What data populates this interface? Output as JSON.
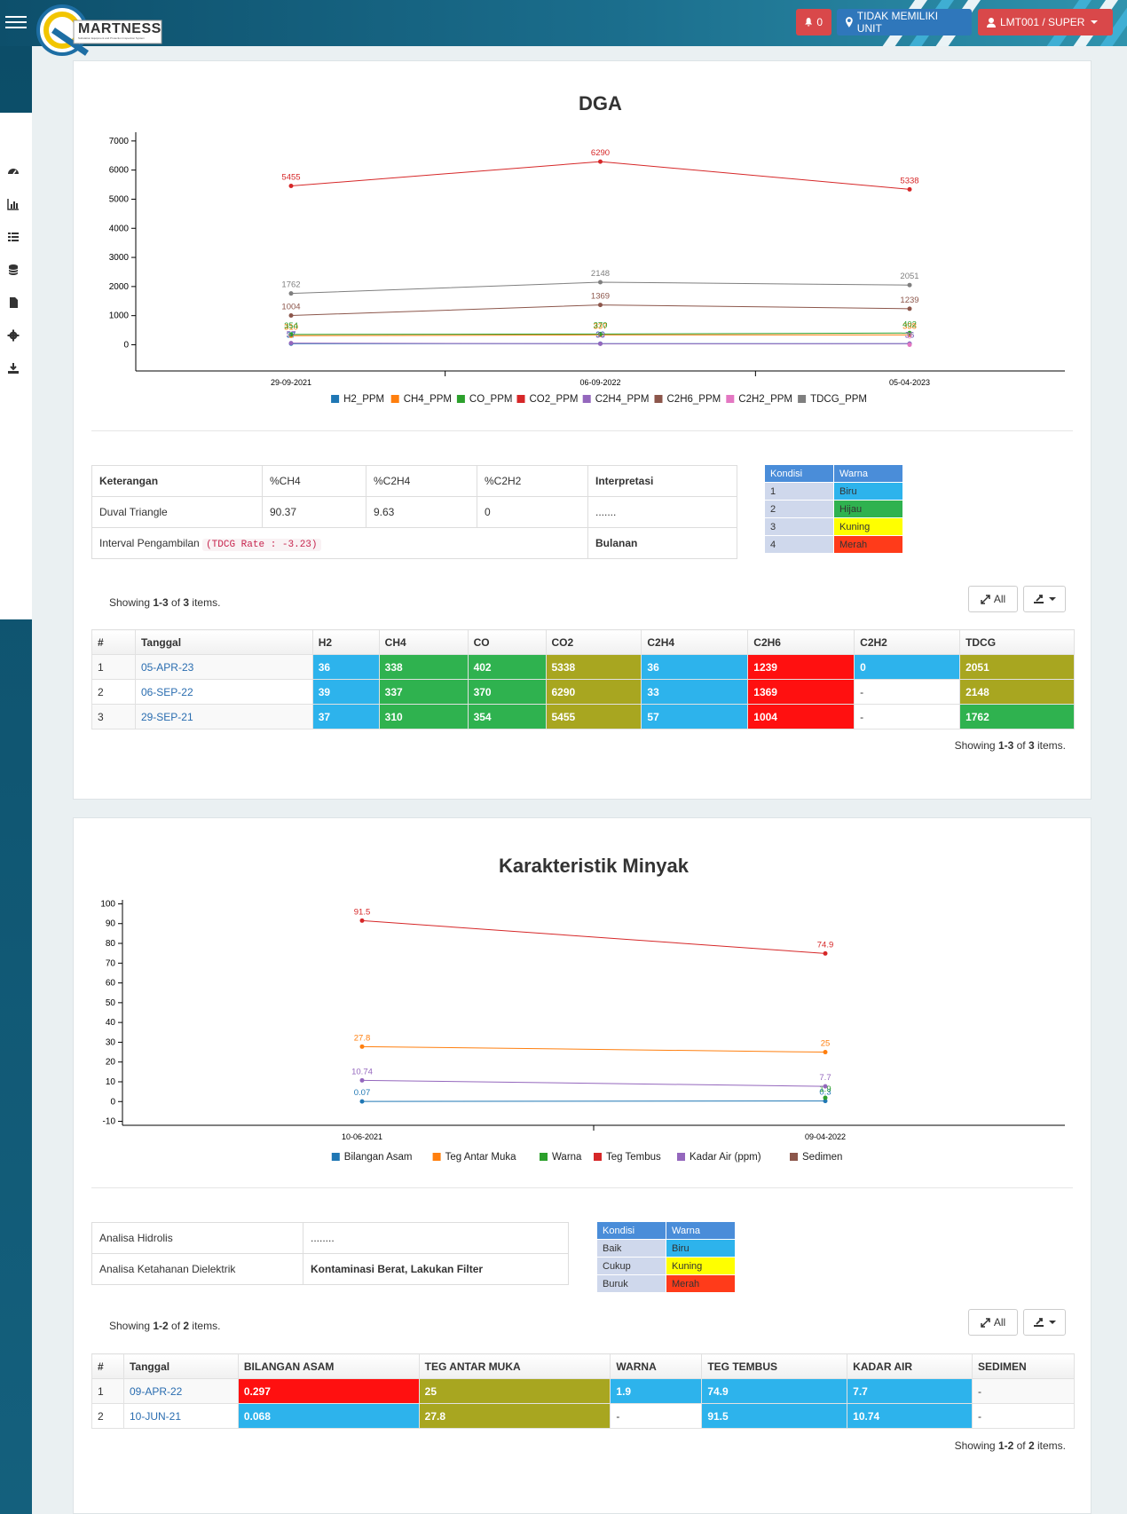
{
  "topbar": {
    "logo_text": "MARTNESS",
    "logo_sub": "Substation Equipment and Protection Inspection System",
    "notif_count": "0",
    "unit_label": "TIDAK MEMILIKI UNIT",
    "user_label": "LMT001 / SUPER"
  },
  "colors": {
    "blue": "#2db3ec",
    "green": "#2fb24f",
    "yellow": "#ffff00",
    "olive": "#a8a620",
    "red": "#ff1010"
  },
  "dga": {
    "chart_data": {
      "type": "line",
      "title": "DGA",
      "categories": [
        "29-09-2021",
        "06-09-2022",
        "05-04-2023"
      ],
      "ylim": [
        -900,
        7300
      ],
      "yticks": [
        0,
        1000,
        2000,
        3000,
        4000,
        5000,
        6000,
        7000
      ],
      "legend_position": "bottom",
      "series": [
        {
          "name": "H2_PPM",
          "color": "#1f77b4",
          "values": [
            37,
            39,
            36
          ]
        },
        {
          "name": "CH4_PPM",
          "color": "#ff7f0e",
          "values": [
            310,
            337,
            338
          ]
        },
        {
          "name": "CO_PPM",
          "color": "#2ca02c",
          "values": [
            354,
            370,
            402
          ]
        },
        {
          "name": "CO2_PPM",
          "color": "#d62728",
          "values": [
            5455,
            6290,
            5338
          ]
        },
        {
          "name": "C2H4_PPM",
          "color": "#9467bd",
          "values": [
            57,
            33,
            36
          ]
        },
        {
          "name": "C2H6_PPM",
          "color": "#8c564b",
          "values": [
            1004,
            1369,
            1239
          ]
        },
        {
          "name": "C2H2_PPM",
          "color": "#e377c2",
          "values": [
            null,
            null,
            0
          ]
        },
        {
          "name": "TDCG_PPM",
          "color": "#7f7f7f",
          "values": [
            1762,
            2148,
            2051
          ]
        }
      ]
    },
    "info": {
      "headers": [
        "Keterangan",
        "%CH4",
        "%C2H4",
        "%C2H2",
        "Interpretasi"
      ],
      "duval": [
        "Duval Triangle",
        "90.37",
        "9.63",
        "0",
        "......."
      ],
      "interval_label": "Interval Pengambilan",
      "interval_code": "(TDCG Rate : -3.23)",
      "interval_value": "Bulanan"
    },
    "kondisi": {
      "headers": [
        "Kondisi",
        "Warna"
      ],
      "rows": [
        [
          "1",
          "Biru",
          "#2db3ec"
        ],
        [
          "2",
          "Hijau",
          "#2fb24f"
        ],
        [
          "3",
          "Kuning",
          "#ffff00"
        ],
        [
          "4",
          "Merah",
          "#ff3b1a"
        ]
      ]
    },
    "summary": {
      "pre": "Showing ",
      "range": "1-3",
      "mid": " of ",
      "total": "3",
      "post": " items."
    },
    "all_label": "All",
    "table": {
      "headers": [
        "#",
        "Tanggal",
        "H2",
        "CH4",
        "CO",
        "CO2",
        "C2H4",
        "C2H6",
        "C2H2",
        "TDCG"
      ],
      "rows": [
        [
          [
            "1",
            "p"
          ],
          [
            "05-APR-23",
            "lnk"
          ],
          [
            "36",
            "cblue"
          ],
          [
            "338",
            "cgreen"
          ],
          [
            "402",
            "cgreen"
          ],
          [
            "5338",
            "colive"
          ],
          [
            "36",
            "cblue"
          ],
          [
            "1239",
            "cred"
          ],
          [
            "0",
            "cblue"
          ],
          [
            "2051",
            "colive"
          ]
        ],
        [
          [
            "2",
            "p"
          ],
          [
            "06-SEP-22",
            "lnk"
          ],
          [
            "39",
            "cblue"
          ],
          [
            "337",
            "cgreen"
          ],
          [
            "370",
            "cgreen"
          ],
          [
            "6290",
            "colive"
          ],
          [
            "33",
            "cblue"
          ],
          [
            "1369",
            "cred"
          ],
          [
            "-",
            "cwhite"
          ],
          [
            "2148",
            "colive"
          ]
        ],
        [
          [
            "3",
            "p"
          ],
          [
            "29-SEP-21",
            "lnk"
          ],
          [
            "37",
            "cblue"
          ],
          [
            "310",
            "cgreen"
          ],
          [
            "354",
            "cgreen"
          ],
          [
            "5455",
            "colive"
          ],
          [
            "57",
            "cblue"
          ],
          [
            "1004",
            "cred"
          ],
          [
            "-",
            "cwhite"
          ],
          [
            "1762",
            "cgreen"
          ]
        ]
      ]
    }
  },
  "minyak": {
    "chart_data": {
      "type": "line",
      "title": "Karakteristik Minyak",
      "categories": [
        "10-06-2021",
        "09-04-2022"
      ],
      "ylim": [
        -12,
        102
      ],
      "yticks": [
        -10,
        0,
        10,
        20,
        30,
        40,
        50,
        60,
        70,
        80,
        90,
        100
      ],
      "legend_position": "bottom",
      "series": [
        {
          "name": "Bilangan Asam",
          "color": "#1f77b4",
          "values": [
            0.07,
            0.3
          ]
        },
        {
          "name": "Teg Antar Muka",
          "color": "#ff7f0e",
          "values": [
            27.8,
            25
          ]
        },
        {
          "name": "Warna",
          "color": "#2ca02c",
          "values": [
            null,
            1.9
          ]
        },
        {
          "name": "Teg Tembus",
          "color": "#d62728",
          "values": [
            91.5,
            74.9
          ]
        },
        {
          "name": "Kadar Air (ppm)",
          "color": "#9467bd",
          "values": [
            10.74,
            7.7
          ]
        },
        {
          "name": "Sedimen",
          "color": "#8c564b",
          "values": [
            null,
            null
          ]
        }
      ]
    },
    "info": {
      "rows": [
        [
          "Analisa Hidrolis",
          "........"
        ],
        [
          "Analisa Ketahanan Dielektrik",
          "Kontaminasi Berat, Lakukan Filter"
        ]
      ]
    },
    "kondisi": {
      "headers": [
        "Kondisi",
        "Warna"
      ],
      "rows": [
        [
          "Baik",
          "Biru",
          "#2db3ec"
        ],
        [
          "Cukup",
          "Kuning",
          "#ffff00"
        ],
        [
          "Buruk",
          "Merah",
          "#ff3b1a"
        ]
      ]
    },
    "summary": {
      "pre": "Showing ",
      "range": "1-2",
      "mid": " of ",
      "total": "2",
      "post": " items."
    },
    "all_label": "All",
    "table": {
      "headers": [
        "#",
        "Tanggal",
        "BILANGAN ASAM",
        "TEG ANTAR MUKA",
        "WARNA",
        "TEG TEMBUS",
        "KADAR AIR",
        "SEDIMEN"
      ],
      "rows": [
        [
          [
            "1",
            "p"
          ],
          [
            "09-APR-22",
            "lnk"
          ],
          [
            "0.297",
            "cred"
          ],
          [
            "25",
            "colive"
          ],
          [
            "1.9",
            "cblue"
          ],
          [
            "74.9",
            "cblue"
          ],
          [
            "7.7",
            "cblue"
          ],
          [
            "-",
            "p"
          ]
        ],
        [
          [
            "2",
            "p"
          ],
          [
            "10-JUN-21",
            "lnk"
          ],
          [
            "0.068",
            "cblue"
          ],
          [
            "27.8",
            "colive"
          ],
          [
            "-",
            "p"
          ],
          [
            "91.5",
            "cblue"
          ],
          [
            "10.74",
            "cblue"
          ],
          [
            "-",
            "p"
          ]
        ]
      ]
    }
  }
}
